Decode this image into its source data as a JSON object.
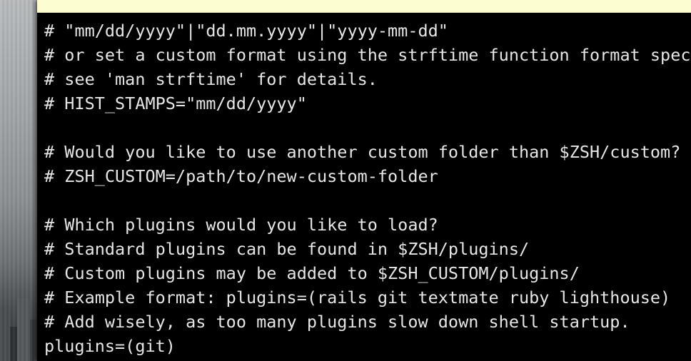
{
  "terminal": {
    "lines": [
      "# \"mm/dd/yyyy\"|\"dd.mm.yyyy\"|\"yyyy-mm-dd\"",
      "# or set a custom format using the strftime function format speci",
      "# see 'man strftime' for details.",
      "# HIST_STAMPS=\"mm/dd/yyyy\"",
      "",
      "# Would you like to use another custom folder than $ZSH/custom?",
      "# ZSH_CUSTOM=/path/to/new-custom-folder",
      "",
      "# Which plugins would you like to load?",
      "# Standard plugins can be found in $ZSH/plugins/",
      "# Custom plugins may be added to $ZSH_CUSTOM/plugins/",
      "# Example format: plugins=(rails git textmate ruby lighthouse)",
      "# Add wisely, as too many plugins slow down shell startup.",
      "plugins=(git)"
    ]
  },
  "colors": {
    "terminal_background": "#000000",
    "terminal_text": "#e6e6e6",
    "notice_bar": "#fdfdd2"
  }
}
